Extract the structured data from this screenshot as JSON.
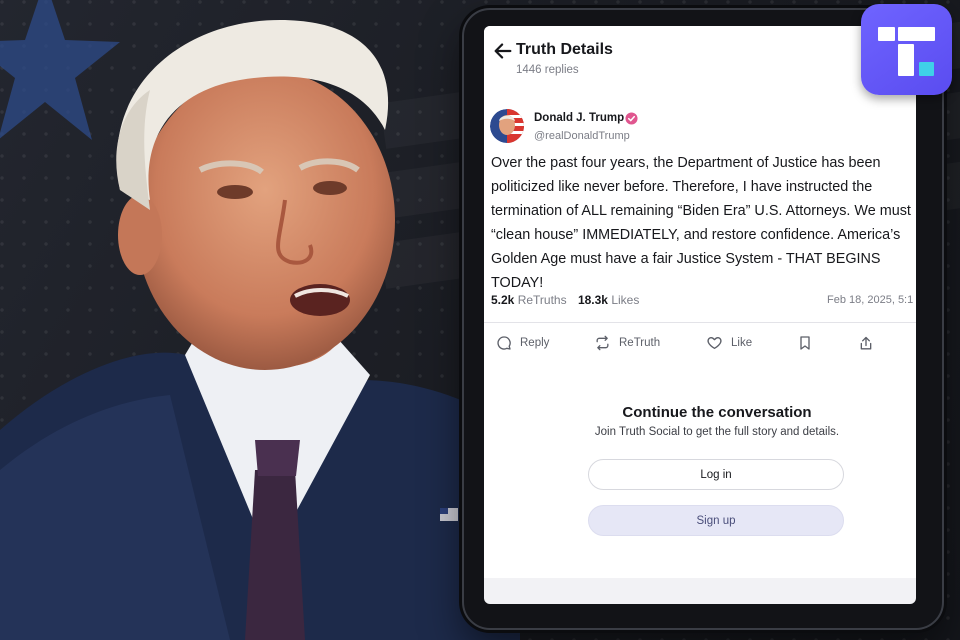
{
  "header": {
    "title": "Truth Details",
    "replies": "1446 replies"
  },
  "post": {
    "author_name": "Donald J. Trump",
    "handle": "@realDonaldTrump",
    "text": "Over the past four years, the Department of Justice has been politicized like never before. Therefore, I have instructed the termination of ALL remaining “Biden Era” U.S. Attorneys. We must “clean house” IMMEDIATELY, and restore confidence. America’s Golden Age must have a fair Justice System - THAT BEGINS TODAY!",
    "retruths_count": "5.2k",
    "retruths_label": "ReTruths",
    "likes_count": "18.3k",
    "likes_label": "Likes",
    "date": "Feb 18, 2025, 5:1"
  },
  "actions": {
    "reply": "Reply",
    "retruth": "ReTruth",
    "like": "Like"
  },
  "cta": {
    "title": "Continue the conversation",
    "subtitle": "Join Truth Social to get the full story and details.",
    "login": "Log in",
    "signup": "Sign up"
  },
  "icons": {
    "back": "arrow-left-icon",
    "verified": "verified-badge-icon",
    "reply": "comment-icon",
    "retruth": "repost-icon",
    "like": "heart-icon",
    "bookmark": "bookmark-icon",
    "share": "share-icon",
    "logo": "truth-social-logo"
  },
  "colors": {
    "brand": "#5a4cf0",
    "verified": "#e0568f",
    "signup_bg": "#e6e7f6"
  }
}
